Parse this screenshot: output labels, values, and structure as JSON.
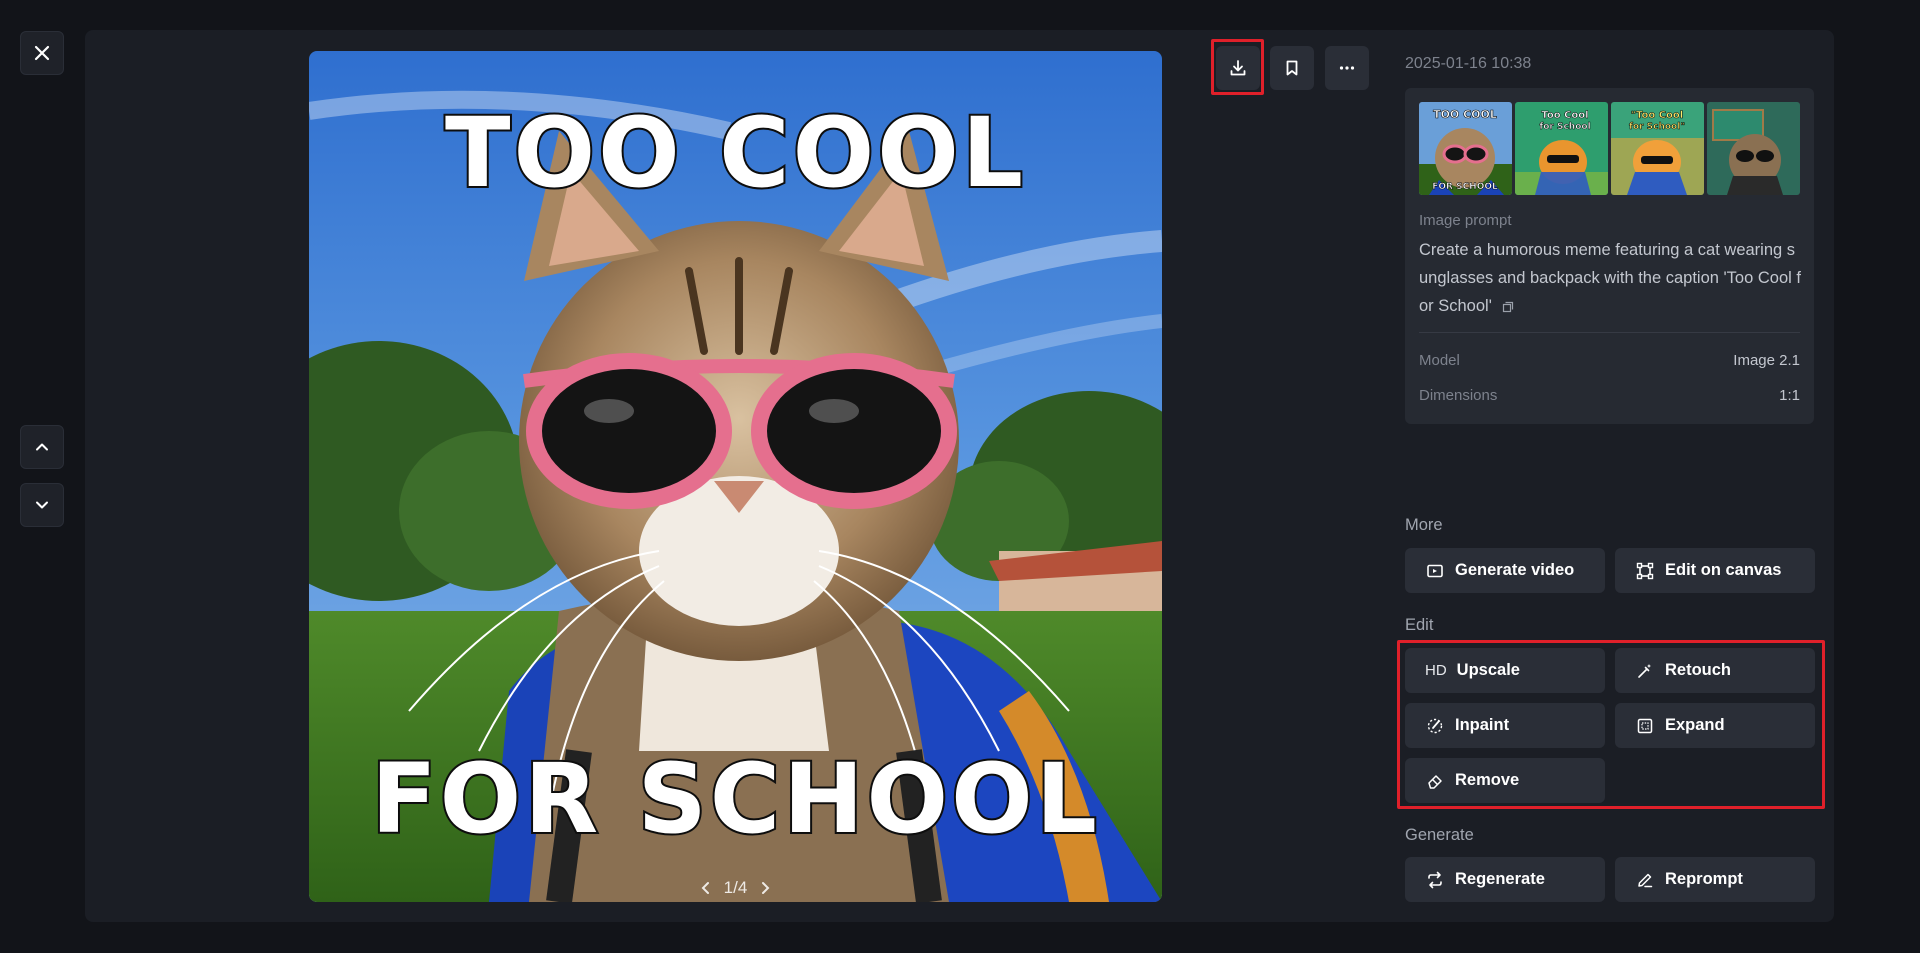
{
  "window": {
    "close_icon": "close-icon",
    "nav_up_icon": "chevron-up-icon",
    "nav_down_icon": "chevron-down-icon"
  },
  "image": {
    "caption_top": "TOO COOL",
    "caption_bottom": "FOR SCHOOL",
    "pager": "1/4"
  },
  "toolbar": {
    "download_icon": "download-icon",
    "bookmark_icon": "bookmark-icon",
    "more_icon": "more-horizontal-icon"
  },
  "details": {
    "timestamp": "2025-01-16 10:38",
    "thumbnails": [
      {
        "caption_top": "TOO COOL",
        "caption_bottom": "FOR SCHOOL"
      },
      {
        "caption_top": "Too Cool",
        "caption_bottom": "for School"
      },
      {
        "caption_top": "\"Too Cool",
        "caption_bottom": "for School\""
      },
      {
        "caption_top": "",
        "caption_bottom": ""
      }
    ],
    "prompt_label": "Image prompt",
    "prompt_text": "Create a humorous meme featuring a cat wearing sunglasses and backpack with the caption 'Too Cool for School'",
    "model_label": "Model",
    "model_value": "Image 2.1",
    "dimensions_label": "Dimensions",
    "dimensions_value": "1:1"
  },
  "more": {
    "label": "More",
    "generate_video": "Generate video",
    "edit_on_canvas": "Edit on canvas"
  },
  "edit": {
    "label": "Edit",
    "upscale_icon_text": "HD",
    "upscale": "Upscale",
    "retouch": "Retouch",
    "inpaint": "Inpaint",
    "expand": "Expand",
    "remove": "Remove"
  },
  "generate": {
    "label": "Generate",
    "regenerate": "Regenerate",
    "reprompt": "Reprompt"
  },
  "colors": {
    "background": "#121419",
    "panel": "#1b1e25",
    "button": "#2a2e37",
    "highlight": "#e0202a"
  }
}
